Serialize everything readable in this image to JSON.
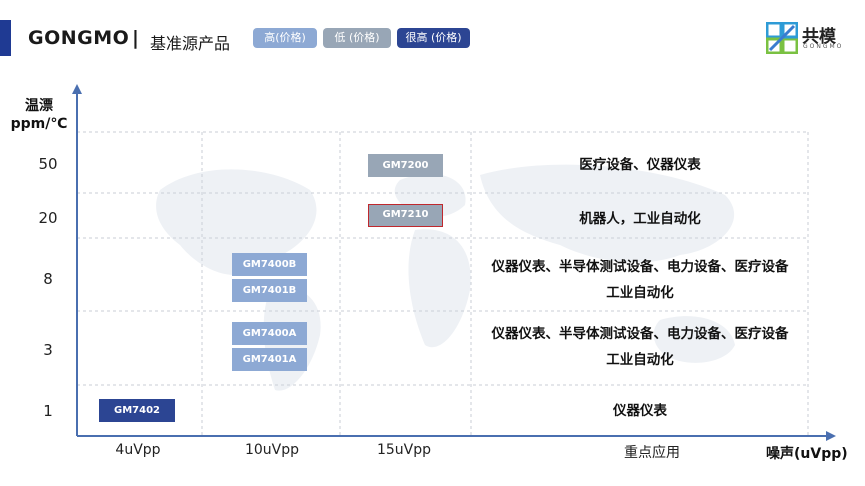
{
  "header": {
    "brand": "GONGMO",
    "separator": "|",
    "title": "基准源产品",
    "legend": [
      {
        "label": "高(价格)",
        "color": "#8da9d4"
      },
      {
        "label": "低 (价格)",
        "color": "#98a6b6"
      },
      {
        "label": "很高 (价格)",
        "color": "#2c4593"
      }
    ]
  },
  "logo": {
    "name": "共模",
    "sub": "GONGMO",
    "icon": "gongmo-logo-icon"
  },
  "axes": {
    "y_title_line1": "温漂",
    "y_title_line2": "ppm/℃",
    "x_title": "噪声(uVpp)",
    "y_ticks": [
      "50",
      "20",
      "8",
      "3",
      "1"
    ],
    "x_ticks": [
      "4uVpp",
      "10uVpp",
      "15uVpp",
      "重点应用"
    ]
  },
  "products": [
    {
      "name": "GM7200",
      "tier": "low"
    },
    {
      "name": "GM7210",
      "tier": "low"
    },
    {
      "name": "GM7400B",
      "tier": "high"
    },
    {
      "name": "GM7401B",
      "tier": "high"
    },
    {
      "name": "GM7400A",
      "tier": "high"
    },
    {
      "name": "GM7401A",
      "tier": "high"
    },
    {
      "name": "GM7402",
      "tier": "very_high"
    }
  ],
  "applications": [
    {
      "line1": "医疗设备、仪器仪表",
      "line2": ""
    },
    {
      "line1": "机器人，工业自动化",
      "line2": ""
    },
    {
      "line1": "仪器仪表、半导体测试设备、电力设备、医疗设备",
      "line2": "工业自动化"
    },
    {
      "line1": "仪器仪表、半导体测试设备、电力设备、医疗设备",
      "line2": "工业自动化"
    },
    {
      "line1": "仪器仪表",
      "line2": ""
    }
  ],
  "colors": {
    "axis": "#4a6fb0",
    "highlight_border": "#c0282d",
    "grid": "#c9ced6"
  }
}
